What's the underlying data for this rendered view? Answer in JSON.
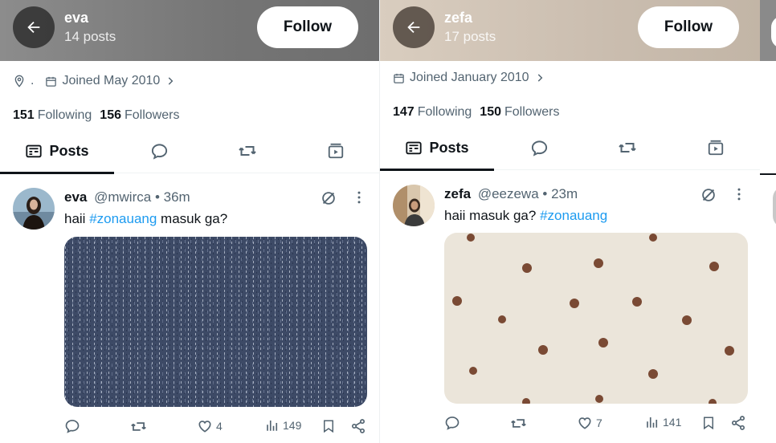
{
  "panels": [
    {
      "header": {
        "name": "eva",
        "posts": "14 posts",
        "follow": "Follow"
      },
      "meta": {
        "location": ".",
        "joined": "Joined May 2010"
      },
      "follows": {
        "following_count": "151",
        "following_label": "Following",
        "followers_count": "156",
        "followers_label": "Followers"
      },
      "tabs": {
        "posts": "Posts"
      },
      "post": {
        "name": "eva",
        "handle": "@mwirca",
        "time": "• 36m",
        "text_before": "haii ",
        "hashtag": "#zonauang",
        "text_after": " masuk ga?",
        "likes": "4",
        "views": "149"
      }
    },
    {
      "header": {
        "name": "zefa",
        "posts": "17 posts",
        "follow": "Follow"
      },
      "meta": {
        "joined": "Joined January 2010"
      },
      "follows": {
        "following_count": "147",
        "following_label": "Following",
        "followers_count": "150",
        "followers_label": "Followers"
      },
      "tabs": {
        "posts": "Posts"
      },
      "post": {
        "name": "zefa",
        "handle": "@eezewa",
        "time": "• 23m",
        "text_before": "haii masuk ga? ",
        "hashtag": "#zonauang",
        "text_after": "",
        "likes": "7",
        "views": "141"
      }
    }
  ],
  "icons": [
    "back-arrow-icon",
    "location-icon",
    "calendar-icon",
    "chevron-right-icon",
    "posts-tab-icon",
    "replies-tab-icon",
    "reposts-tab-icon",
    "media-tab-icon",
    "grok-icon",
    "more-icon",
    "reply-icon",
    "repost-icon",
    "like-icon",
    "views-icon",
    "bookmark-icon",
    "share-icon"
  ],
  "colors": {
    "accent": "#1d9bf0",
    "text": "#0f1419",
    "muted": "#536471"
  }
}
